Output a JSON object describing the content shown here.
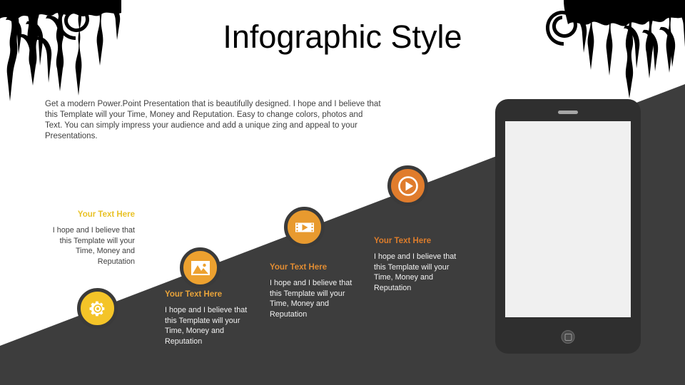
{
  "slide": {
    "title": "Infographic Style",
    "intro": "Get a modern Power.Point  Presentation that is beautifully designed. I hope and I believe that this Template will your Time, Money and Reputation. Easy to change colors, photos and Text. You can simply impress your audience and add a unique zing and appeal to your Presentations.",
    "background_color": "#ffffff",
    "wedge_color": "#3d3d3d",
    "grunge_color": "#000000"
  },
  "blocks": [
    {
      "heading": "Your Text Here",
      "body": "I hope and I believe that this Template will your Time, Money and Reputation",
      "heading_color": "#e9c227",
      "body_color": "#3f3f3f",
      "icon": "gear-icon",
      "badge_color": "#f4c428"
    },
    {
      "heading": "Your Text Here",
      "body": "I hope and I believe that this Template will your Time, Money and Reputation",
      "heading_color": "#e8a33a",
      "body_color": "#f2f2f2",
      "icon": "image-icon",
      "badge_color": "#eda12f"
    },
    {
      "heading": "Your Text Here",
      "body": "I hope and I believe that this Template will your Time, Money and Reputation",
      "heading_color": "#e08c33",
      "body_color": "#f2f2f2",
      "icon": "video-player-icon",
      "badge_color": "#e89a2f"
    },
    {
      "heading": "Your Text Here",
      "body": "I hope and I believe that this Template will your Time, Money and Reputation",
      "heading_color": "#dd7d2c",
      "body_color": "#f2f2f2",
      "icon": "play-circle-icon",
      "badge_color": "#e07c2c"
    }
  ],
  "device": {
    "type": "tablet-mockup",
    "frame_color": "#2f2f2f",
    "screen_color": "#f0f0f0",
    "screen_content": ""
  }
}
